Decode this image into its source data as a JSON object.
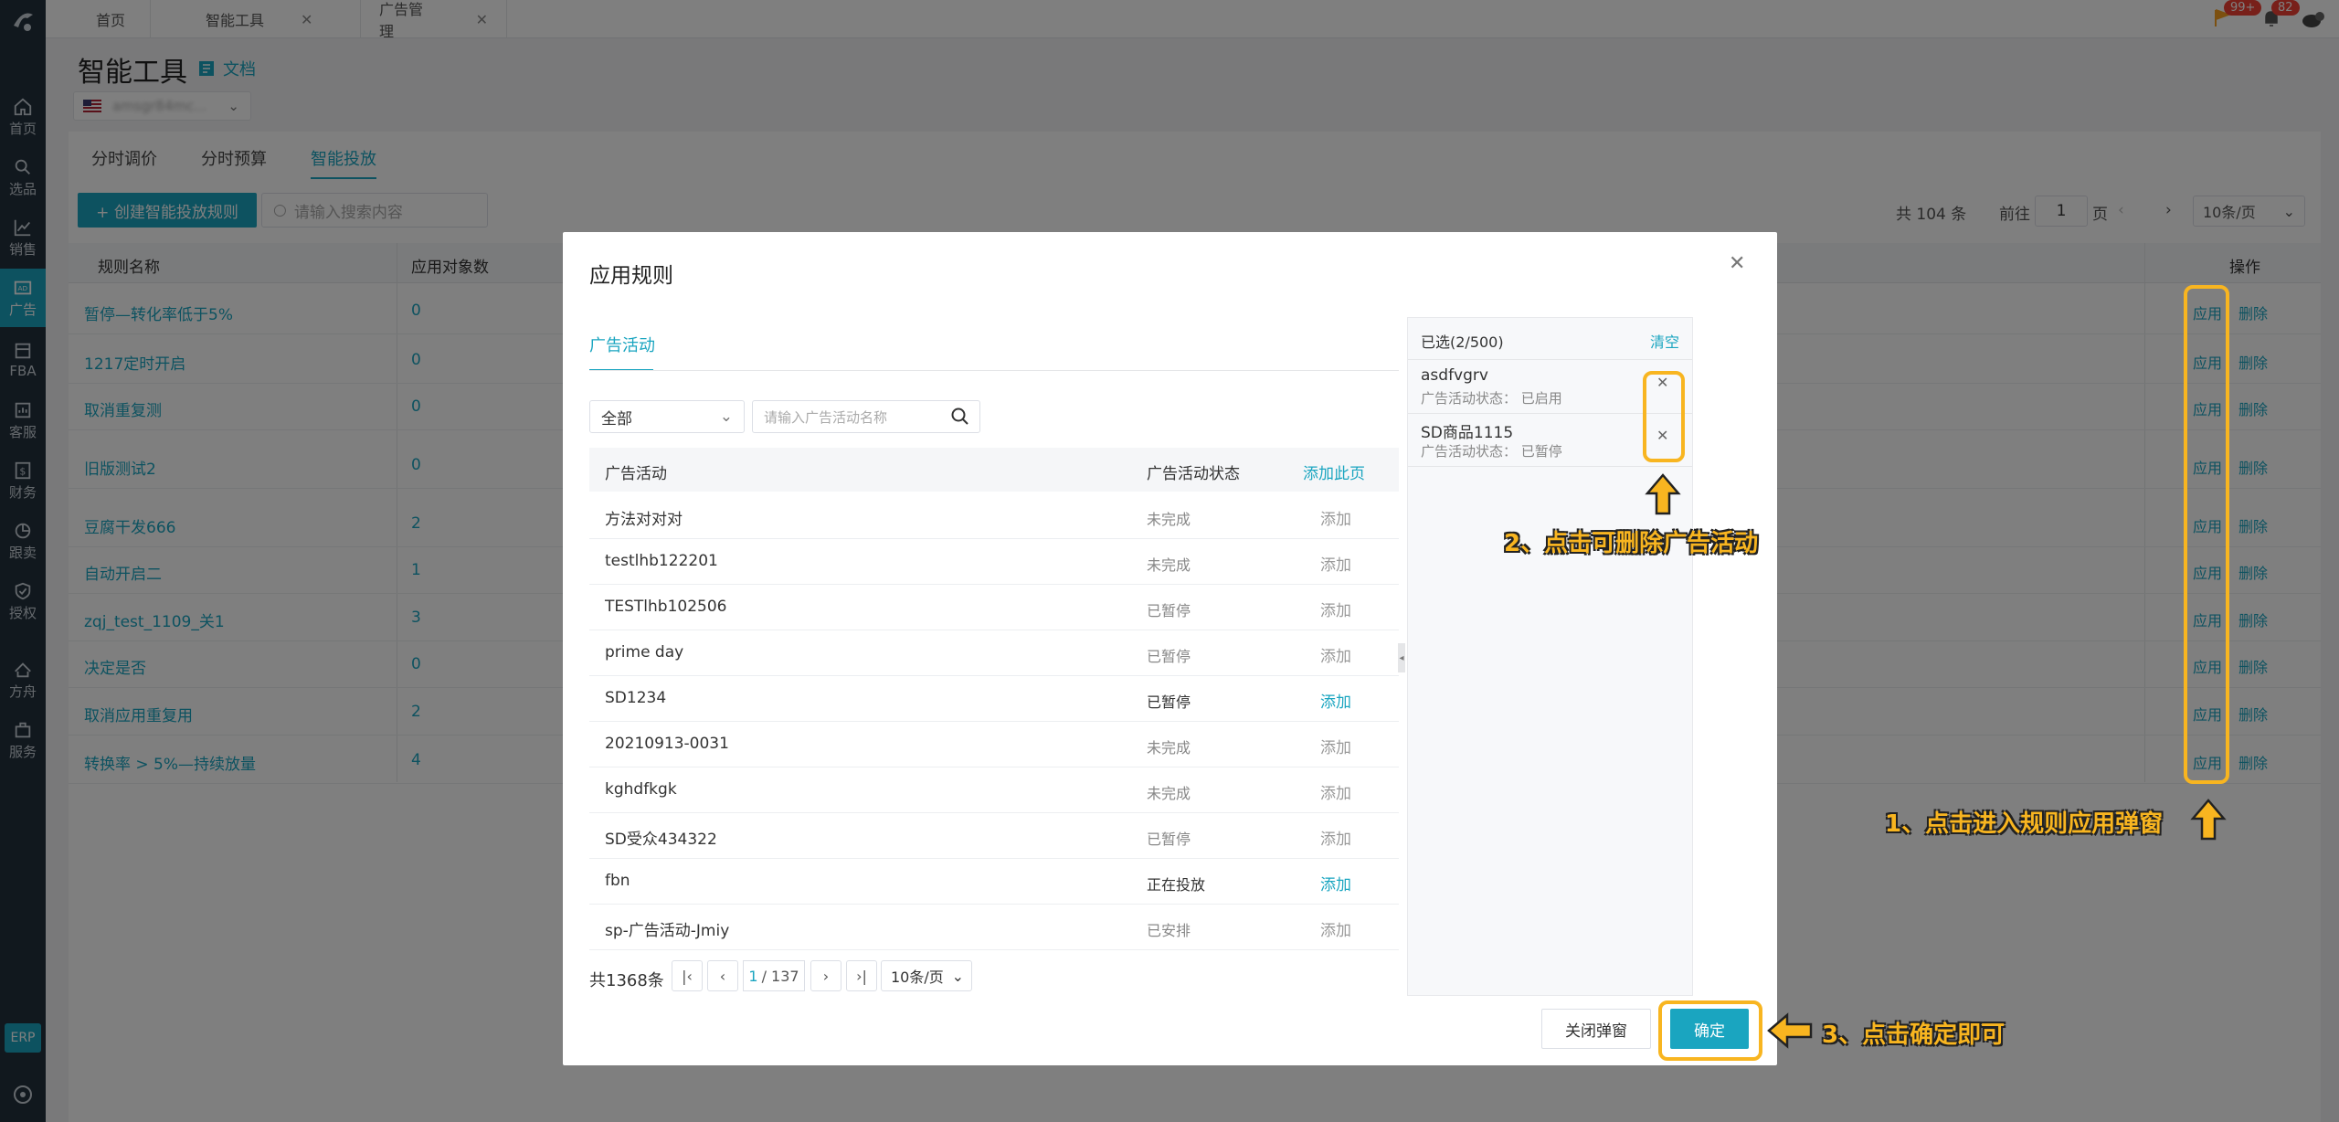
{
  "sidebar": {
    "items": [
      {
        "label": "首页",
        "icon": "home-icon"
      },
      {
        "label": "选品",
        "icon": "search-icon"
      },
      {
        "label": "销售",
        "icon": "chart-icon"
      },
      {
        "label": "广告",
        "icon": "ad-icon"
      },
      {
        "label": "FBA",
        "icon": "box-icon"
      },
      {
        "label": "客服",
        "icon": "message-icon"
      },
      {
        "label": "财务",
        "icon": "dollar-icon"
      },
      {
        "label": "跟卖",
        "icon": "pie-icon"
      },
      {
        "label": "授权",
        "icon": "shield-icon"
      },
      {
        "label": "方舟",
        "icon": "ark-icon"
      },
      {
        "label": "服务",
        "icon": "service-icon"
      }
    ],
    "erp": "ERP"
  },
  "tabs": [
    {
      "label": "首页",
      "closable": false
    },
    {
      "label": "智能工具",
      "closable": true
    },
    {
      "label": "广告管理",
      "closable": true
    }
  ],
  "header": {
    "badge_flag": "99+",
    "badge_bell": "82"
  },
  "page": {
    "title": "智能工具",
    "doc_link": "文档",
    "market": "amsgr84mc...",
    "subtabs": [
      "分时调价",
      "分时预算",
      "智能投放"
    ],
    "create_button": "+ 创建智能投放规则",
    "search_placeholder": "请输入搜索内容",
    "pagination": {
      "total": "共 104 条",
      "goto": "前往",
      "page": "1",
      "page_unit": "页",
      "page_size": "10条/页"
    },
    "columns": {
      "name": "规则名称",
      "count": "应用对象数",
      "ops": "操作"
    },
    "apply_label": "应用",
    "delete_label": "删除",
    "rules": [
      {
        "name": "暂停—转化率低于5%",
        "count": "0"
      },
      {
        "name": "1217定时开启",
        "count": "0"
      },
      {
        "name": "取消重复测",
        "count": "0"
      },
      {
        "name": "旧版测试2",
        "count": "0"
      },
      {
        "name": "豆腐干发666",
        "count": "2"
      },
      {
        "name": "自动开启二",
        "count": "1"
      },
      {
        "name": "zqj_test_1109_关1",
        "count": "3"
      },
      {
        "name": "决定是否",
        "count": "0"
      },
      {
        "name": "取消应用重复用",
        "count": "2"
      },
      {
        "name": "转换率 > 5%—持续放量",
        "count": "4"
      }
    ]
  },
  "modal": {
    "title": "应用规则",
    "tab": "广告活动",
    "status_select": "全部",
    "search_placeholder": "请输入广告活动名称",
    "columns": {
      "campaign": "广告活动",
      "status": "广告活动状态",
      "add_page": "添加此页"
    },
    "add_label": "添加",
    "campaigns": [
      {
        "name": "方法对对对",
        "status": "未完成",
        "addable": false
      },
      {
        "name": "testlhb122201",
        "status": "未完成",
        "addable": false
      },
      {
        "name": "TESTlhb102506",
        "status": "已暂停",
        "addable": false
      },
      {
        "name": "prime day",
        "status": "已暂停",
        "addable": false
      },
      {
        "name": "SD1234",
        "status": "已暂停",
        "addable": true
      },
      {
        "name": "20210913-0031",
        "status": "未完成",
        "addable": false
      },
      {
        "name": "kghdfkgk",
        "status": "未完成",
        "addable": false
      },
      {
        "name": "SD受众434322",
        "status": "已暂停",
        "addable": false
      },
      {
        "name": "fbn",
        "status": "正在投放",
        "addable": true
      },
      {
        "name": "sp-广告活动-Jmiy",
        "status": "已安排",
        "addable": false
      }
    ],
    "total": "共1368条",
    "current_page": "1",
    "total_pages": "/ 137",
    "page_size": "10条/页",
    "selected_header": "已选(2/500)",
    "clear": "清空",
    "selected": [
      {
        "name": "asdfvgrv",
        "status": "广告活动状态：  已启用"
      },
      {
        "name": "SD商品1115",
        "status": "广告活动状态：  已暂停"
      }
    ],
    "close_button": "关闭弹窗",
    "confirm_button": "确定"
  },
  "annotations": {
    "step1": "1、点击进入规则应用弹窗",
    "step2": "2、点击可删除广告活动",
    "step3": "3、点击确定即可"
  },
  "colors": {
    "accent": "#1aa5c0",
    "highlight": "#f8b520",
    "sidebar": "#22303c"
  }
}
